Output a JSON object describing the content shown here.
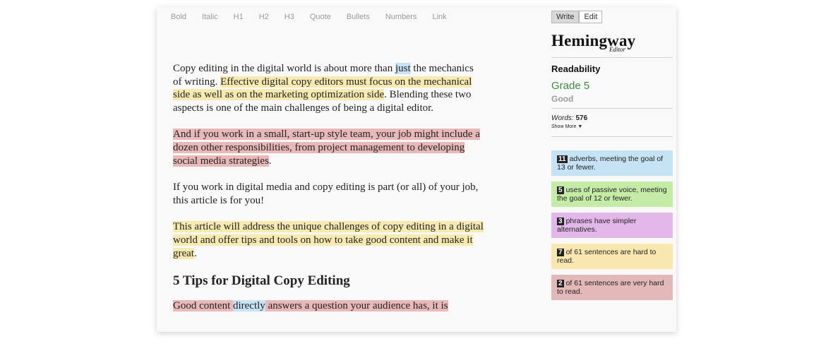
{
  "toolbar": {
    "bold": "Bold",
    "italic": "Italic",
    "h1": "H1",
    "h2": "H2",
    "h3": "H3",
    "quote": "Quote",
    "bullets": "Bullets",
    "numbers": "Numbers",
    "link": "Link"
  },
  "modes": {
    "write": "Write",
    "edit": "Edit"
  },
  "logo": {
    "title": "Hemingway",
    "sub": "Editor"
  },
  "readability": {
    "heading": "Readability",
    "grade": "Grade 5",
    "grade_desc": "Good",
    "words_label": "Words:",
    "words_count": "576",
    "show_more": "Show More"
  },
  "cards": {
    "adverbs": {
      "count": "11",
      "text": "adverbs, meeting the goal of 13 or fewer."
    },
    "passive": {
      "count": "5",
      "text": "uses of passive voice, meeting the goal of 12 or fewer."
    },
    "phrases": {
      "count": "3",
      "text": "phrases have simpler alternatives."
    },
    "hard": {
      "count": "7",
      "text": "of 61 sentences are hard to read."
    },
    "very_hard": {
      "count": "2",
      "text": "of 61 sentences are very hard to read."
    }
  },
  "editor": {
    "p1_a": "Copy editing in the digital world is about more than ",
    "p1_adverb": "just",
    "p1_b": " the mechanics of writing. ",
    "p1_hard": "Effective digital copy editors must focus on the mechanical side as well as on the marketing optimization side",
    "p1_c": ". Blending these two aspects is one of the main challenges of being a digital editor.",
    "p2_very_hard": "And if you work in a small, start-up style team, your job might include a dozen other responsibilities, from project management to developing social media strategies",
    "p2_end": ".",
    "p3": "If you work in digital media and copy editing is part (or all) of your job, this article is for you!",
    "p4_hard": "This article will address the unique challenges of copy editing in a digital world and offer tips and tools on how to take good content and make it great",
    "p4_end": ".",
    "heading": "5 Tips for Digital Copy Editing",
    "p5_a": "Good content ",
    "p5_adverb": "directly",
    "p5_b": " answers a question your audience has, it is"
  },
  "colors": {
    "hard": "#f7eab0",
    "very_hard": "#e9b9b9",
    "adverb": "#c8e3f5",
    "passive": "#c5eca6",
    "phrase": "#e2b7ea",
    "grade": "#3d8c3d"
  }
}
